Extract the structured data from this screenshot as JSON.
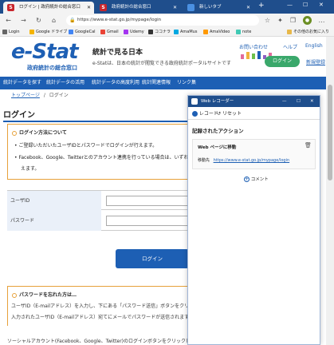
{
  "browser": {
    "tabs": [
      {
        "label": "ログイン | 政府統計の総合窓口",
        "active": true
      },
      {
        "label": "政府統計の総合窓口",
        "active": false
      },
      {
        "label": "新しいタブ",
        "active": false
      }
    ],
    "url": "https://www.e-stat.go.jp/mypage/login",
    "bookmarks": [
      "Login",
      "Google ドライブ",
      "GoogleCal",
      "Gmail",
      "Udemy",
      "ココナラ",
      "AmaMus",
      "AmaVideo",
      "note",
      "その他のお気に入り"
    ]
  },
  "header": {
    "logo": "e-Stat",
    "logo_sub": "政府統計の総合窓口",
    "tagline_title": "統計で見る日本",
    "tagline_text": "e-Statは、日本の統計が閲覧できる政府統計ポータルサイトです",
    "top_links": [
      "お問い合わせ",
      "ヘルプ",
      "English"
    ],
    "login_button": "ログイン",
    "register_link": "新規登録"
  },
  "nav": {
    "items": [
      "統計データを探す",
      "統計データの活用",
      "統計データの高度利用",
      "統計関連情報",
      "リンク集"
    ]
  },
  "breadcrumb": {
    "home": "トップページ",
    "sep": "/",
    "current": "ログイン"
  },
  "page": {
    "title": "ログイン",
    "method_title": "ログイン方法について",
    "method_bullets": [
      "ご登録いただいたユーザIDとパスワードでログインが行えます。",
      "Facebook、Google、Twitterとのアカウント連携を行っている場合は、いずれ"
    ],
    "method_cont": "えます。",
    "userid_label": "ユーザID",
    "password_label": "パスワード",
    "login_button": "ログイン",
    "forgot_title": "パスワードを忘れた方は…",
    "forgot_text1": "ユーザID（E-mailアドレス）を入力し、下にある「パスワード送信」ボタンをクリッ",
    "forgot_text2": "入力されたユーザID（E-mailアドレス）宛てにメールでパスワードが送信されます",
    "social_text": "ソーシャルアカウント(Facebook、Google、Twitter)のログインボタンをクリックし"
  },
  "recorder": {
    "title": "Web レコーダー",
    "record_label": "レコード",
    "reset_label": "リセット",
    "section_title": "記録されたアクション",
    "action_title": "Web ページに移動",
    "action_key": "移動先",
    "action_url": "https://www.e-stat.go.jp/mypage/login",
    "comment_label": "コメント"
  }
}
